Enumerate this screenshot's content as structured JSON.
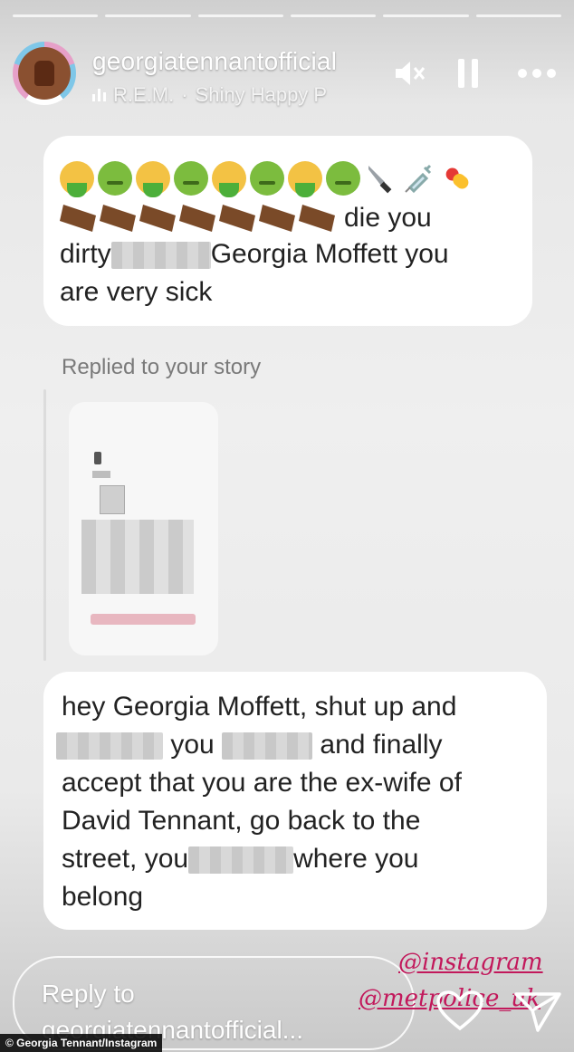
{
  "header": {
    "username": "georgiatennantofficial",
    "music_artist": "R.E.M.",
    "music_separator": "·",
    "music_track": "Shiny Happy P"
  },
  "messages": {
    "first": {
      "emoji_row1": [
        "vomit",
        "sick",
        "vomit",
        "sick",
        "vomit",
        "sick",
        "vomit",
        "sick",
        "knife",
        "syringe",
        "pill"
      ],
      "line1_text": "die you",
      "line2_prefix": "dirty",
      "line2_suffix": "Georgia Moffett you",
      "line3": "are very sick"
    },
    "replied_label": "Replied to your story",
    "second": {
      "line1": "hey Georgia Moffett, shut up and",
      "line2_mid": "you",
      "line2_end": "and finally",
      "line3": "accept that you are the ex-wife of",
      "line4": "David Tennant, go back to the",
      "line5_prefix": "street, you",
      "line5_suffix": "where you",
      "line6": "belong"
    }
  },
  "footer": {
    "reply_line1": "Reply to",
    "reply_line2": "georgiatennantofficial...",
    "mention1": "@instagram",
    "mention2": "@metpolice_uk"
  },
  "credit": "© Georgia Tennant/Instagram",
  "icons": [
    "mute-icon",
    "pause-icon",
    "more-icon",
    "heart-icon",
    "send-icon"
  ],
  "colors": {
    "mention": "#c2185b"
  }
}
